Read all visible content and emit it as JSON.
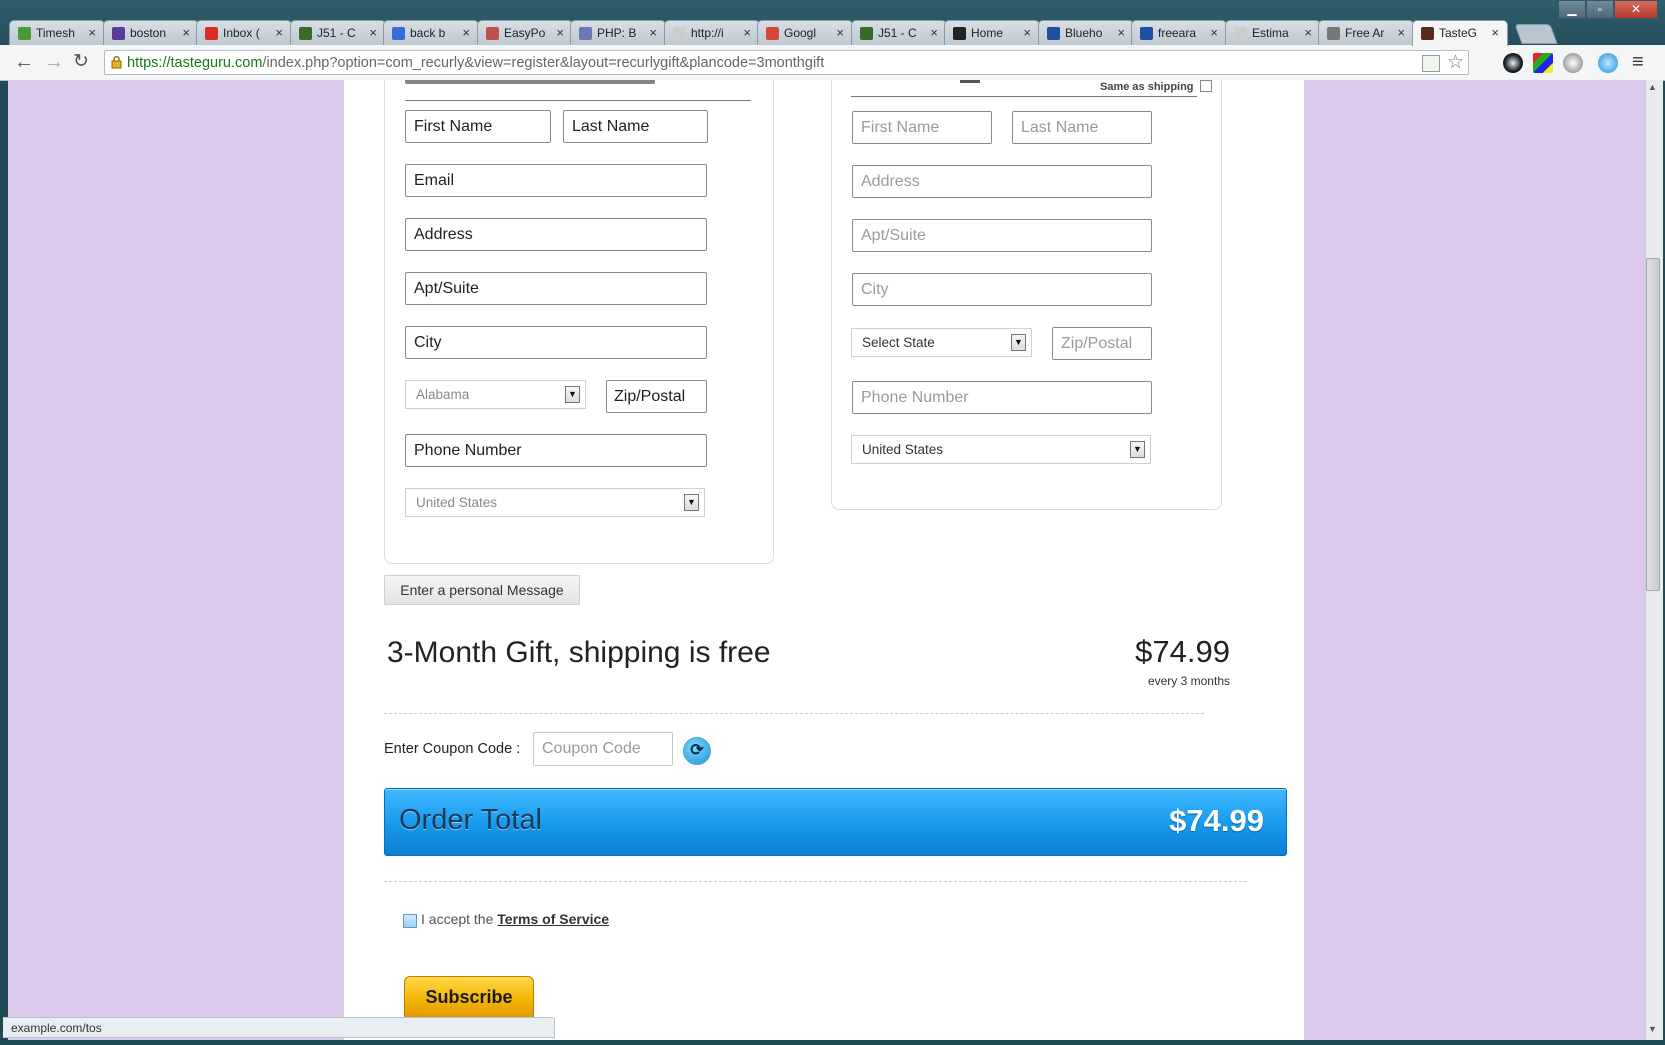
{
  "browser": {
    "tabs": [
      {
        "label": "Timesh",
        "icon": "leaf-icon",
        "color": "#4a9a3a"
      },
      {
        "label": "boston",
        "icon": "peace-icon",
        "color": "#5a3a9a"
      },
      {
        "label": "Inbox (",
        "icon": "gmail-icon",
        "color": "#d93025"
      },
      {
        "label": "J51 - C",
        "icon": "j51-icon",
        "color": "#3a6a2a"
      },
      {
        "label": "back b",
        "icon": "google-icon",
        "color": "#3a6ad9"
      },
      {
        "label": "EasyPo",
        "icon": "page-icon",
        "color": "#c0504d"
      },
      {
        "label": "PHP: B",
        "icon": "php-icon",
        "color": "#6a7ab0"
      },
      {
        "label": "http://i",
        "icon": "blank-page-icon",
        "color": "#cccccc"
      },
      {
        "label": "Googl",
        "icon": "google-plus-icon",
        "color": "#d34836"
      },
      {
        "label": "J51 - C",
        "icon": "j51-icon",
        "color": "#3a6a2a"
      },
      {
        "label": "Home",
        "icon": "x-icon",
        "color": "#222222"
      },
      {
        "label": "Blueho",
        "icon": "grid-icon",
        "color": "#1f4fa0"
      },
      {
        "label": "freeara",
        "icon": "grid-icon",
        "color": "#1f4fa0"
      },
      {
        "label": "Estima",
        "icon": "blank-page-icon",
        "color": "#cccccc"
      },
      {
        "label": "Free Ar",
        "icon": "arrow-icon",
        "color": "#777777"
      },
      {
        "label": "TasteG",
        "icon": "tg-icon",
        "color": "#5a2a1a",
        "active": true
      }
    ],
    "url_scheme": "https://",
    "url_host": "tasteguru.com",
    "url_path": "/index.php?option=com_recurly&view=register&layout=recurlygift&plancode=3monthgift",
    "status_url": "example.com/tos"
  },
  "shipping": {
    "first_name_placeholder": "First Name",
    "last_name_placeholder": "Last Name",
    "email_placeholder": "Email",
    "address_placeholder": "Address",
    "apt_placeholder": "Apt/Suite",
    "city_placeholder": "City",
    "state_value": "Alabama",
    "zip_placeholder": "Zip/Postal",
    "phone_placeholder": "Phone Number",
    "country_value": "United States"
  },
  "billing": {
    "same_as_shipping_label": "Same as shipping",
    "first_name_placeholder": "First Name",
    "last_name_placeholder": "Last Name",
    "address_placeholder": "Address",
    "apt_placeholder": "Apt/Suite",
    "city_placeholder": "City",
    "state_value": "Select State",
    "zip_placeholder": "Zip/Postal",
    "phone_placeholder": "Phone Number",
    "country_value": "United States"
  },
  "message_button_label": "Enter a personal Message",
  "plan": {
    "title": "3-Month Gift, shipping is free",
    "price": "$74.99",
    "period": "every 3 months"
  },
  "coupon": {
    "label": "Enter Coupon Code :",
    "placeholder": "Coupon Code"
  },
  "order": {
    "label": "Order Total",
    "amount": "$74.99"
  },
  "terms": {
    "prefix": "I accept the",
    "link": "Terms of Service"
  },
  "subscribe_label": "Subscribe",
  "colors": {
    "page_background": "#dcc9eb",
    "order_bar": "#1699ec",
    "subscribe": "#f2b400"
  }
}
